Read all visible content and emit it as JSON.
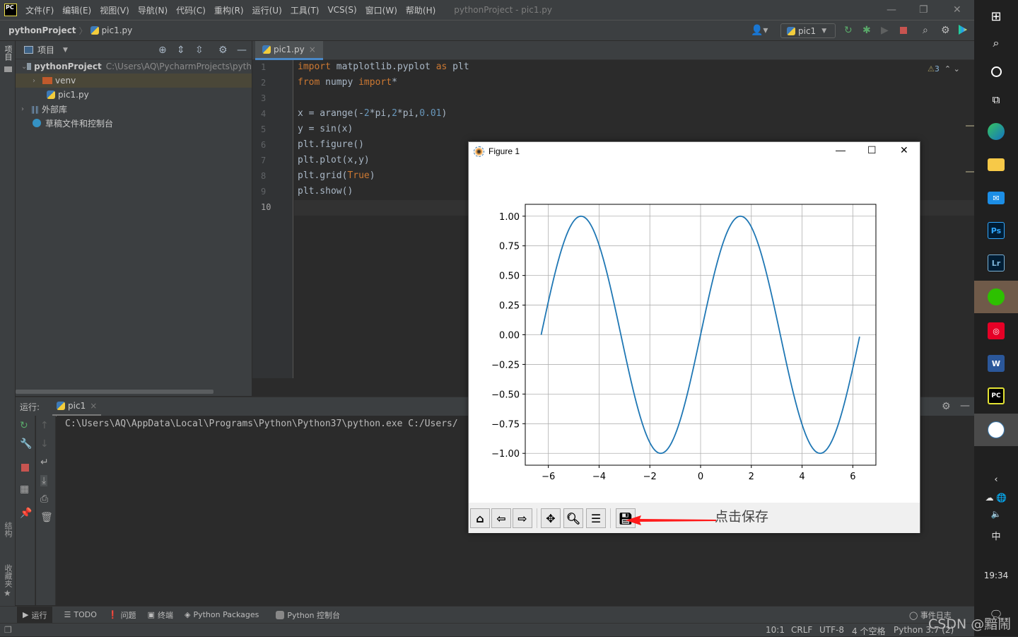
{
  "titlebar": {
    "logo": "PC",
    "menus": [
      "文件(F)",
      "编辑(E)",
      "视图(V)",
      "导航(N)",
      "代码(C)",
      "重构(R)",
      "运行(U)",
      "工具(T)",
      "VCS(S)",
      "窗口(W)",
      "帮助(H)"
    ],
    "window_title": "pythonProject - pic1.py",
    "controls": {
      "minimize": "—",
      "restore": "❐",
      "close": "✕"
    }
  },
  "navbar": {
    "project": "pythonProject",
    "file": "pic1.py",
    "run_config": "pic1"
  },
  "left_strip": {
    "project_tab": "项目",
    "structure_tab": "结构",
    "favorites_tab": "收藏夹"
  },
  "project_panel": {
    "header": "项目",
    "tree": [
      {
        "label": "pythonProject",
        "path": "C:\\Users\\AQ\\PycharmProjects\\pyth",
        "type": "project-folder",
        "expanded": true
      },
      {
        "label": "venv",
        "type": "excluded-folder",
        "expanded": false,
        "selected": true
      },
      {
        "label": "pic1.py",
        "type": "python-file"
      },
      {
        "label": "外部库",
        "type": "library",
        "expanded": false
      },
      {
        "label": "草稿文件和控制台",
        "type": "scratches"
      }
    ]
  },
  "editor": {
    "tab": "pic1.py",
    "inspection_count": "3",
    "line_numbers": [
      "1",
      "2",
      "3",
      "4",
      "5",
      "6",
      "7",
      "8",
      "9",
      "10"
    ],
    "lines": [
      [
        {
          "t": "import",
          "c": "kw"
        },
        {
          "t": " matplotlib.pyplot "
        },
        {
          "t": "as",
          "c": "kw"
        },
        {
          "t": " plt"
        }
      ],
      [
        {
          "t": "from",
          "c": "kw"
        },
        {
          "t": " numpy "
        },
        {
          "t": "import",
          "c": "kw"
        },
        {
          "t": "*"
        }
      ],
      [],
      [
        {
          "t": "x = arange(-"
        },
        {
          "t": "2",
          "c": "num"
        },
        {
          "t": "*pi,"
        },
        {
          "t": "2",
          "c": "num"
        },
        {
          "t": "*pi,"
        },
        {
          "t": "0.01",
          "c": "num"
        },
        {
          "t": ")"
        }
      ],
      [
        {
          "t": "y = sin(x)"
        }
      ],
      [
        {
          "t": "plt.figure()"
        }
      ],
      [
        {
          "t": "plt.plot(x,y)"
        }
      ],
      [
        {
          "t": "plt.grid("
        },
        {
          "t": "True",
          "c": "kw"
        },
        {
          "t": ")"
        }
      ],
      [
        {
          "t": "plt.show()"
        }
      ],
      []
    ]
  },
  "run_panel": {
    "label": "运行:",
    "tab": "pic1",
    "console": "C:\\Users\\AQ\\AppData\\Local\\Programs\\Python\\Python37\\python.exe C:/Users/"
  },
  "bottom_tools": [
    "运行",
    "TODO",
    "问题",
    "终端",
    "Python Packages",
    "Python 控制台"
  ],
  "event_log": "事件日志",
  "statusbar": {
    "position": "10:1",
    "line_sep": "CRLF",
    "encoding": "UTF-8",
    "indent": "4 个空格",
    "interpreter": "Python 3.7 (2)"
  },
  "taskbar": {
    "clock": "19:34",
    "ime": "中"
  },
  "watermark": "CSDN @黯鬧",
  "figure_window": {
    "title": "Figure 1",
    "toolbar": [
      "home",
      "back",
      "forward",
      "pan",
      "zoom",
      "configure-subplots",
      "save"
    ],
    "annotation": "点击保存",
    "annotation_color": "#ff1a1a"
  },
  "chart_data": {
    "type": "line",
    "title": "",
    "xlabel": "",
    "ylabel": "",
    "function": "y = sin(x), x = arange(-2*pi, 2*pi, 0.01)",
    "x_range": [
      -6.2832,
      6.2832
    ],
    "xlim": [
      -6.91,
      6.91
    ],
    "ylim": [
      -1.1,
      1.1
    ],
    "xticks": [
      -6,
      -4,
      -2,
      0,
      2,
      4,
      6
    ],
    "xtick_labels": [
      "−6",
      "−4",
      "−2",
      "0",
      "2",
      "4",
      "6"
    ],
    "yticks": [
      1.0,
      0.75,
      0.5,
      0.25,
      0.0,
      -0.25,
      -0.5,
      -0.75,
      -1.0
    ],
    "ytick_labels": [
      "1.00",
      "0.75",
      "0.50",
      "0.25",
      "0.00",
      "−0.25",
      "−0.50",
      "−0.75",
      "−1.00"
    ],
    "grid": true,
    "series": [
      {
        "name": "sin(x)",
        "color": "#1f77b4",
        "x": [
          -6.28,
          -5.5,
          -4.71,
          -3.93,
          -3.14,
          -2.36,
          -1.57,
          -0.79,
          0,
          0.79,
          1.57,
          2.36,
          3.14,
          3.93,
          4.71,
          5.5,
          6.28
        ],
        "y": [
          0,
          0.71,
          1,
          0.71,
          0,
          -0.71,
          -1,
          -0.71,
          0,
          0.71,
          1,
          0.71,
          0,
          -0.71,
          -1,
          -0.71,
          0
        ]
      }
    ]
  }
}
